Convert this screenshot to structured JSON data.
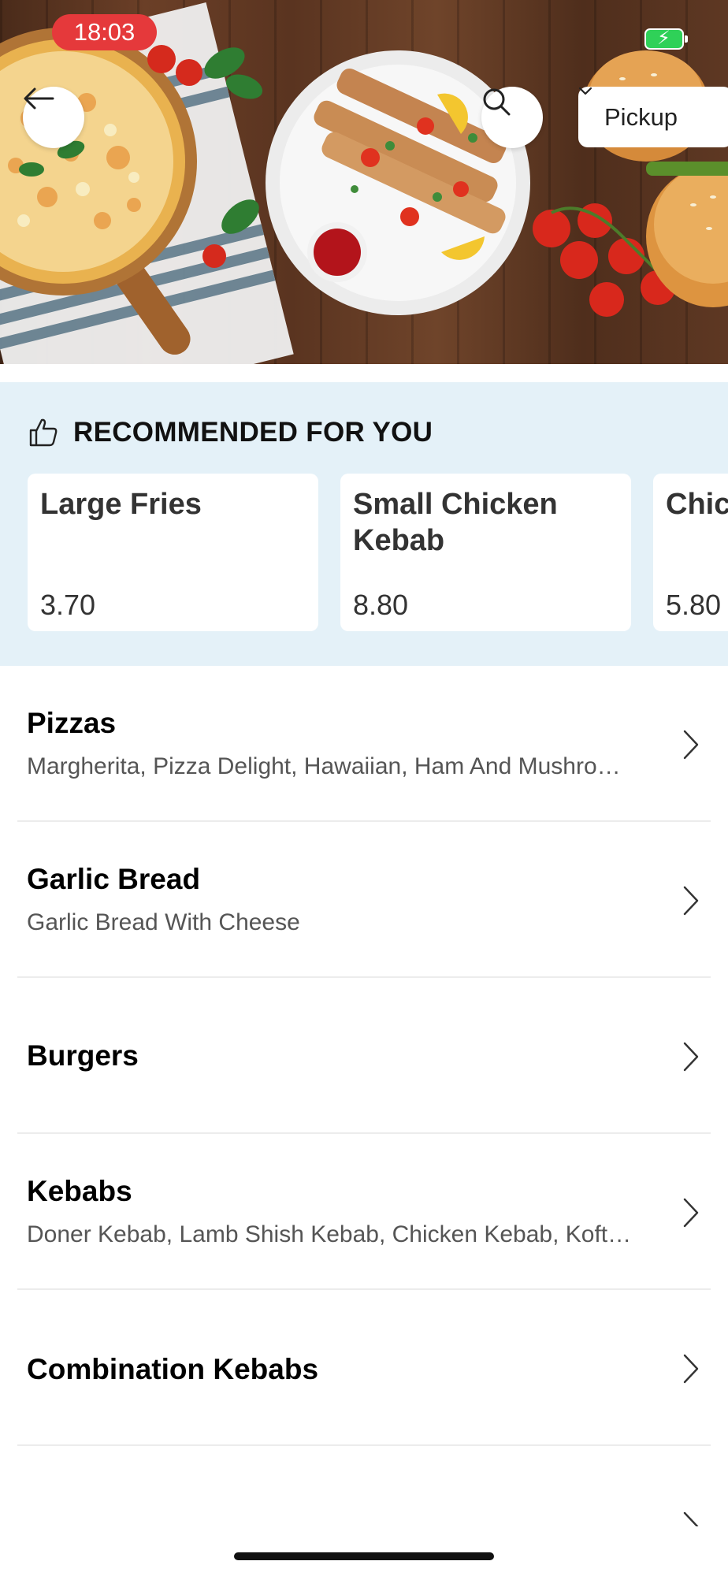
{
  "status_bar": {
    "time": "18:03"
  },
  "header": {
    "pickup_label": "Pickup"
  },
  "icons": {
    "back": "arrow-left-icon",
    "search": "search-icon",
    "pickup_chevron": "chevron-down-icon",
    "recommend": "thumbs-up-icon",
    "row_chevron": "chevron-right-icon",
    "battery": "battery-charging-icon"
  },
  "recommended": {
    "title": "RECOMMENDED FOR YOU",
    "items": [
      {
        "name": "Large Fries",
        "price": "3.70"
      },
      {
        "name": "Small Chicken Kebab",
        "price": "8.80"
      },
      {
        "name": "Chicken Burger",
        "price": "5.80"
      }
    ]
  },
  "categories": [
    {
      "title": "Pizzas",
      "subtitle": "Margherita, Pizza Delight, Hawaiian, Ham And Mushro…"
    },
    {
      "title": "Garlic Bread",
      "subtitle": "Garlic Bread With Cheese"
    },
    {
      "title": "Burgers",
      "subtitle": ""
    },
    {
      "title": "Kebabs",
      "subtitle": "Doner Kebab, Lamb Shish Kebab, Chicken Kebab, Koft…"
    },
    {
      "title": "Combination Kebabs",
      "subtitle": ""
    }
  ],
  "colors": {
    "status_pill": "#e5393b",
    "recommended_bg": "#e4f1f8",
    "battery": "#2fd158"
  }
}
